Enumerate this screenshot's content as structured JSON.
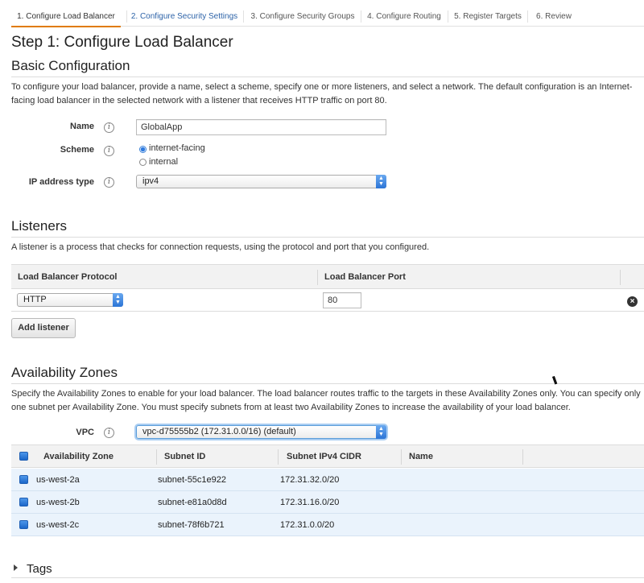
{
  "wizard": {
    "steps": [
      {
        "label": "1. Configure Load Balancer",
        "state": "active"
      },
      {
        "label": "2. Configure Security Settings",
        "state": "next"
      },
      {
        "label": "3. Configure Security Groups",
        "state": "pending"
      },
      {
        "label": "4. Configure Routing",
        "state": "pending"
      },
      {
        "label": "5. Register Targets",
        "state": "pending"
      },
      {
        "label": "6. Review",
        "state": "pending"
      }
    ]
  },
  "page": {
    "title": "Step 1: Configure Load Balancer"
  },
  "basic": {
    "heading": "Basic Configuration",
    "description": "To configure your load balancer, provide a name, select a scheme, specify one or more listeners, and select a network. The default configuration is an Internet-facing load balancer in the selected network with a listener that receives HTTP traffic on port 80.",
    "name_label": "Name",
    "name_value": "GlobalApp",
    "scheme_label": "Scheme",
    "scheme_options": [
      {
        "label": "internet-facing",
        "checked": true
      },
      {
        "label": "internal",
        "checked": false
      }
    ],
    "ip_label": "IP address type",
    "ip_value": "ipv4"
  },
  "listeners": {
    "heading": "Listeners",
    "description": "A listener is a process that checks for connection requests, using the protocol and port that you configured.",
    "col_protocol": "Load Balancer Protocol",
    "col_port": "Load Balancer Port",
    "rows": [
      {
        "protocol": "HTTP",
        "port": "80"
      }
    ],
    "add_button": "Add listener"
  },
  "zones": {
    "heading": "Availability Zones",
    "description": "Specify the Availability Zones to enable for your load balancer. The load balancer routes traffic to the targets in these Availability Zones only. You can specify only one subnet per Availability Zone. You must specify subnets from at least two Availability Zones to increase the availability of your load balancer.",
    "vpc_label": "VPC",
    "vpc_value": "vpc-d75555b2 (172.31.0.0/16) (default)",
    "columns": [
      "Availability Zone",
      "Subnet ID",
      "Subnet IPv4 CIDR",
      "Name"
    ],
    "rows": [
      {
        "zone": "us-west-2a",
        "subnet": "subnet-55c1e922",
        "cidr": "172.31.32.0/20",
        "name": "",
        "checked": true
      },
      {
        "zone": "us-west-2b",
        "subnet": "subnet-e81a0d8d",
        "cidr": "172.31.16.0/20",
        "name": "",
        "checked": true
      },
      {
        "zone": "us-west-2c",
        "subnet": "subnet-78f6b721",
        "cidr": "172.31.0.0/20",
        "name": "",
        "checked": true
      }
    ]
  },
  "tags": {
    "heading": "Tags"
  },
  "icons": {
    "info": "i",
    "remove": "×",
    "arrow_up": "▲",
    "arrow_down": "▼"
  },
  "colors": {
    "active_tab_underline": "#e07b00",
    "link_blue": "#2d63a8",
    "selected_row": "#eaf3fc",
    "select_arrow": "#2b74d6"
  }
}
